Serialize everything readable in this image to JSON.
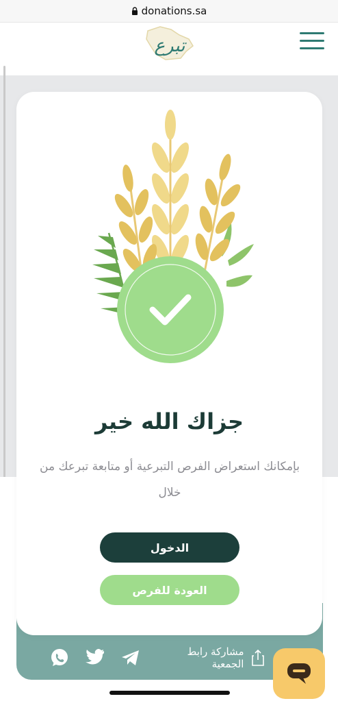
{
  "browser": {
    "url": "donations.sa"
  },
  "header": {
    "logo_text": "تبرع",
    "menu_icon": "hamburger-menu-icon"
  },
  "card": {
    "illustration_icon": "wheat-check-icon",
    "title": "جزاك الله خير",
    "description": "بإمكانك استعراض الفرص التبرعية أو متابعة تبرعك من خلال",
    "login_button": "الدخول",
    "back_button": "العودة للفرص"
  },
  "share": {
    "label": "مشاركة رابط الجمعية",
    "icons": [
      "share-icon",
      "telegram-icon",
      "twitter-icon",
      "whatsapp-icon"
    ]
  },
  "colors": {
    "primary_dark": "#1c3f3b",
    "primary_light": "#9fdc8c",
    "teal": "#2e7a72",
    "share_bar": "#7aa8a2",
    "chat": "#f7c96a"
  }
}
